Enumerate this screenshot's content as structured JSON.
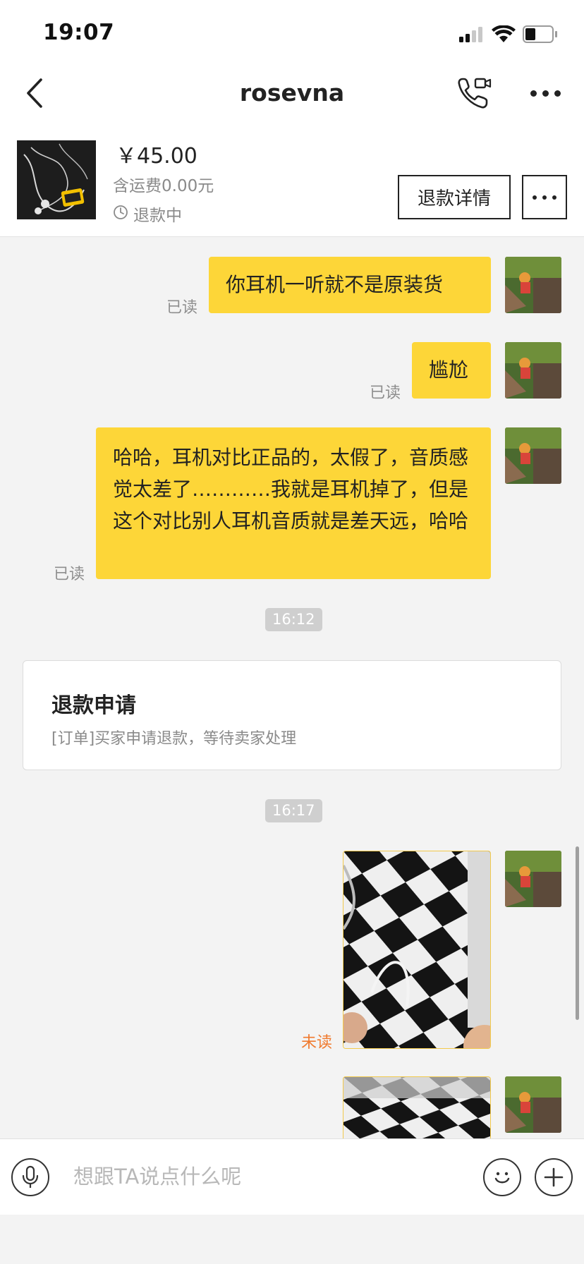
{
  "status_bar": {
    "time": "19:07"
  },
  "nav": {
    "title": "rosevna",
    "back_icon": "chevron-left-icon",
    "call_icon": "phone-video-icon",
    "more_icon": "more-horizontal-icon"
  },
  "product": {
    "price": "￥45.00",
    "shipping": "含运费0.00元",
    "status": "退款中",
    "refund_details_label": "退款详情"
  },
  "messages": [
    {
      "text": "你耳机一听就不是原装货",
      "status": "已读"
    },
    {
      "text": "尴尬",
      "status": "已读"
    },
    {
      "text": "哈哈，耳机对比正品的，太假了，音质感觉太差了…………我就是耳机掉了，但是这个对比别人耳机音质就是差天远，哈哈",
      "status": "已读"
    }
  ],
  "timestamps": [
    "16:12",
    "16:17"
  ],
  "refund_card": {
    "title": "退款申请",
    "description": "[订单]买家申请退款，等待卖家处理"
  },
  "image_message": {
    "status": "未读"
  },
  "input": {
    "placeholder": "想跟TA说点什么呢"
  },
  "colors": {
    "bubble": "#fdd638",
    "unread": "#f07a2e",
    "read": "#8e8e8e",
    "timestamp_pill": "#cfcfcf"
  }
}
